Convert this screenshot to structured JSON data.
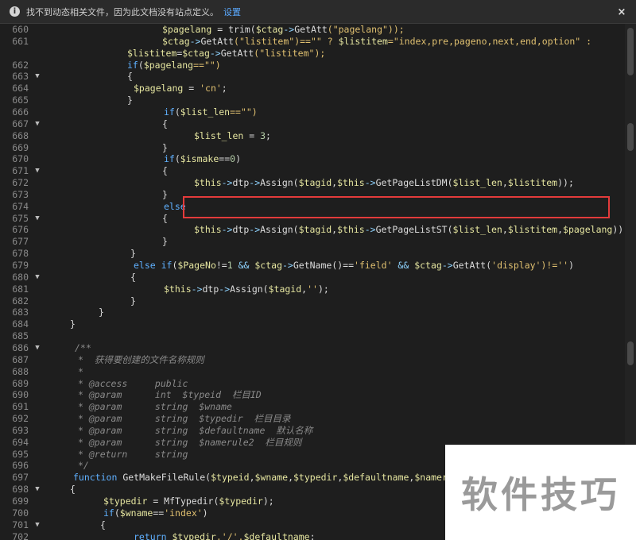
{
  "infobar": {
    "message": "找不到动态相关文件，因为此文档没有站点定义。",
    "link_label": "设置",
    "info_icon": "i",
    "close_icon": "×"
  },
  "watermark": "软件技巧",
  "lines": [
    {
      "num": "660",
      "fold": false,
      "indent": 204,
      "tokens": [
        [
          "$pagelang",
          "var"
        ],
        [
          " = ",
          "plain"
        ],
        [
          "trim",
          "fn"
        ],
        [
          "(",
          "plain"
        ],
        [
          "$ctag",
          "var"
        ],
        [
          "->",
          "op"
        ],
        [
          "GetAtt",
          "fn"
        ],
        [
          "(\"pagelang\"));",
          "str"
        ]
      ]
    },
    {
      "num": "661",
      "fold": false,
      "indent": 204,
      "tokens": [
        [
          "$ctag",
          "var"
        ],
        [
          "->",
          "op"
        ],
        [
          "GetAtt",
          "fn"
        ],
        [
          "(\"listitem\")==\"\" ? ",
          "str"
        ],
        [
          "$listitem",
          "var"
        ],
        [
          "=\"index,pre,pageno,next,end,option\" :",
          "str"
        ]
      ]
    },
    {
      "num": "",
      "fold": false,
      "indent": 160,
      "tokens": [
        [
          "$listitem",
          "var"
        ],
        [
          "=",
          "plain"
        ],
        [
          "$ctag",
          "var"
        ],
        [
          "->",
          "op"
        ],
        [
          "GetAtt",
          "fn"
        ],
        [
          "(\"listitem\");",
          "str"
        ]
      ]
    },
    {
      "num": "662",
      "fold": false,
      "indent": 160,
      "tokens": [
        [
          "if",
          "kw"
        ],
        [
          "(",
          "plain"
        ],
        [
          "$pagelang",
          "var"
        ],
        [
          "==\"\")",
          "str"
        ]
      ]
    },
    {
      "num": "663",
      "fold": true,
      "indent": 160,
      "tokens": [
        [
          "{",
          "plain"
        ]
      ]
    },
    {
      "num": "664",
      "fold": false,
      "indent": 168,
      "tokens": [
        [
          "$pagelang",
          "var"
        ],
        [
          " = ",
          "plain"
        ],
        [
          "'cn'",
          "str"
        ],
        [
          ";",
          "plain"
        ]
      ]
    },
    {
      "num": "665",
      "fold": false,
      "indent": 160,
      "tokens": [
        [
          "}",
          "plain"
        ]
      ]
    },
    {
      "num": "666",
      "fold": false,
      "indent": 206,
      "tokens": [
        [
          "if",
          "kw"
        ],
        [
          "(",
          "plain"
        ],
        [
          "$list_len",
          "var"
        ],
        [
          "==\"\")",
          "str"
        ]
      ]
    },
    {
      "num": "667",
      "fold": true,
      "indent": 204,
      "tokens": [
        [
          "{",
          "plain"
        ]
      ]
    },
    {
      "num": "668",
      "fold": false,
      "indent": 244,
      "tokens": [
        [
          "$list_len",
          "var"
        ],
        [
          " = ",
          "plain"
        ],
        [
          "3",
          "num"
        ],
        [
          ";",
          "plain"
        ]
      ]
    },
    {
      "num": "669",
      "fold": false,
      "indent": 204,
      "tokens": [
        [
          "}",
          "plain"
        ]
      ]
    },
    {
      "num": "670",
      "fold": false,
      "indent": 206,
      "tokens": [
        [
          "if",
          "kw"
        ],
        [
          "(",
          "plain"
        ],
        [
          "$ismake",
          "var"
        ],
        [
          "==",
          "plain"
        ],
        [
          "0",
          "num"
        ],
        [
          ")",
          "plain"
        ]
      ]
    },
    {
      "num": "671",
      "fold": true,
      "indent": 204,
      "tokens": [
        [
          "{",
          "plain"
        ]
      ]
    },
    {
      "num": "672",
      "fold": false,
      "indent": 244,
      "tokens": [
        [
          "$this",
          "var"
        ],
        [
          "->",
          "op"
        ],
        [
          "dtp",
          "plain"
        ],
        [
          "->",
          "op"
        ],
        [
          "Assign",
          "fn"
        ],
        [
          "(",
          "plain"
        ],
        [
          "$tagid",
          "var"
        ],
        [
          ",",
          "plain"
        ],
        [
          "$this",
          "var"
        ],
        [
          "->",
          "op"
        ],
        [
          "GetPageListDM",
          "fn"
        ],
        [
          "(",
          "plain"
        ],
        [
          "$list_len",
          "var"
        ],
        [
          ",",
          "plain"
        ],
        [
          "$listitem",
          "var"
        ],
        [
          "));",
          "plain"
        ]
      ]
    },
    {
      "num": "673",
      "fold": false,
      "indent": 204,
      "tokens": [
        [
          "}",
          "plain"
        ]
      ]
    },
    {
      "num": "674",
      "fold": false,
      "indent": 206,
      "tokens": [
        [
          "else",
          "kw"
        ]
      ]
    },
    {
      "num": "675",
      "fold": true,
      "indent": 204,
      "tokens": [
        [
          "{",
          "plain"
        ]
      ]
    },
    {
      "num": "676",
      "fold": false,
      "indent": 244,
      "tokens": [
        [
          "$this",
          "var"
        ],
        [
          "->",
          "op"
        ],
        [
          "dtp",
          "plain"
        ],
        [
          "->",
          "op"
        ],
        [
          "Assign",
          "fn"
        ],
        [
          "(",
          "plain"
        ],
        [
          "$tagid",
          "var"
        ],
        [
          ",",
          "plain"
        ],
        [
          "$this",
          "var"
        ],
        [
          "->",
          "op"
        ],
        [
          "GetPageListST",
          "fn"
        ],
        [
          "(",
          "plain"
        ],
        [
          "$list_len",
          "var"
        ],
        [
          ",",
          "plain"
        ],
        [
          "$listitem",
          "var"
        ],
        [
          ",",
          "plain"
        ],
        [
          "$pagelang",
          "var"
        ],
        [
          "));",
          "plain"
        ]
      ]
    },
    {
      "num": "677",
      "fold": false,
      "indent": 204,
      "tokens": [
        [
          "}",
          "plain"
        ]
      ]
    },
    {
      "num": "678",
      "fold": false,
      "indent": 164,
      "tokens": [
        [
          "}",
          "plain"
        ]
      ]
    },
    {
      "num": "679",
      "fold": false,
      "indent": 168,
      "tokens": [
        [
          "else if",
          "kw"
        ],
        [
          "(",
          "plain"
        ],
        [
          "$PageNo",
          "var"
        ],
        [
          "!=",
          "plain"
        ],
        [
          "1",
          "num"
        ],
        [
          " && ",
          "op"
        ],
        [
          "$ctag",
          "var"
        ],
        [
          "->",
          "op"
        ],
        [
          "GetName",
          "fn"
        ],
        [
          "()==",
          "plain"
        ],
        [
          "'field'",
          "str"
        ],
        [
          " && ",
          "op"
        ],
        [
          "$ctag",
          "var"
        ],
        [
          "->",
          "op"
        ],
        [
          "GetAtt",
          "fn"
        ],
        [
          "(",
          "plain"
        ],
        [
          "'display'",
          "str"
        ],
        [
          ")!=''",
          "str"
        ],
        [
          ")",
          "plain"
        ]
      ]
    },
    {
      "num": "680",
      "fold": true,
      "indent": 164,
      "tokens": [
        [
          "{",
          "plain"
        ]
      ]
    },
    {
      "num": "681",
      "fold": false,
      "indent": 206,
      "tokens": [
        [
          "$this",
          "var"
        ],
        [
          "->",
          "op"
        ],
        [
          "dtp",
          "plain"
        ],
        [
          "->",
          "op"
        ],
        [
          "Assign",
          "fn"
        ],
        [
          "(",
          "plain"
        ],
        [
          "$tagid",
          "var"
        ],
        [
          ",",
          "plain"
        ],
        [
          "''",
          "str"
        ],
        [
          ");",
          "plain"
        ]
      ]
    },
    {
      "num": "682",
      "fold": false,
      "indent": 164,
      "tokens": [
        [
          "}",
          "plain"
        ]
      ]
    },
    {
      "num": "683",
      "fold": false,
      "indent": 124,
      "tokens": [
        [
          "}",
          "plain"
        ]
      ]
    },
    {
      "num": "684",
      "fold": false,
      "indent": 88,
      "tokens": [
        [
          "}",
          "plain"
        ]
      ]
    },
    {
      "num": "685",
      "fold": false,
      "indent": 88,
      "tokens": []
    },
    {
      "num": "686",
      "fold": true,
      "indent": 94,
      "tokens": [
        [
          "/**",
          "cmt"
        ]
      ]
    },
    {
      "num": "687",
      "fold": false,
      "indent": 98,
      "tokens": [
        [
          "*  获得要创建的文件名称规则",
          "cmt"
        ]
      ]
    },
    {
      "num": "688",
      "fold": false,
      "indent": 98,
      "tokens": [
        [
          "*",
          "cmt"
        ]
      ]
    },
    {
      "num": "689",
      "fold": false,
      "indent": 98,
      "tokens": [
        [
          "* @access     public",
          "cmt"
        ]
      ]
    },
    {
      "num": "690",
      "fold": false,
      "indent": 98,
      "tokens": [
        [
          "* @param      int  $typeid  栏目ID",
          "cmt"
        ]
      ]
    },
    {
      "num": "691",
      "fold": false,
      "indent": 98,
      "tokens": [
        [
          "* @param      string  $wname",
          "cmt"
        ]
      ]
    },
    {
      "num": "692",
      "fold": false,
      "indent": 98,
      "tokens": [
        [
          "* @param      string  $typedir  栏目目录",
          "cmt"
        ]
      ]
    },
    {
      "num": "693",
      "fold": false,
      "indent": 98,
      "tokens": [
        [
          "* @param      string  $defaultname  默认名称",
          "cmt"
        ]
      ]
    },
    {
      "num": "694",
      "fold": false,
      "indent": 98,
      "tokens": [
        [
          "* @param      string  $namerule2  栏目规则",
          "cmt"
        ]
      ]
    },
    {
      "num": "695",
      "fold": false,
      "indent": 98,
      "tokens": [
        [
          "* @return     string",
          "cmt"
        ]
      ]
    },
    {
      "num": "696",
      "fold": false,
      "indent": 98,
      "tokens": [
        [
          "*/",
          "cmt"
        ]
      ]
    },
    {
      "num": "697",
      "fold": false,
      "indent": 92,
      "tokens": [
        [
          "function ",
          "kw"
        ],
        [
          "GetMakeFileRule",
          "fn"
        ],
        [
          "(",
          "plain"
        ],
        [
          "$typeid",
          "var"
        ],
        [
          ",",
          "plain"
        ],
        [
          "$wname",
          "var"
        ],
        [
          ",",
          "plain"
        ],
        [
          "$typedir",
          "var"
        ],
        [
          ",",
          "plain"
        ],
        [
          "$defaultname",
          "var"
        ],
        [
          ",",
          "plain"
        ],
        [
          "$namerule",
          "var"
        ]
      ]
    },
    {
      "num": "698",
      "fold": true,
      "indent": 88,
      "tokens": [
        [
          "{",
          "plain"
        ]
      ]
    },
    {
      "num": "699",
      "fold": false,
      "indent": 130,
      "tokens": [
        [
          "$typedir",
          "var"
        ],
        [
          " = ",
          "plain"
        ],
        [
          "MfTypedir",
          "fn"
        ],
        [
          "(",
          "plain"
        ],
        [
          "$typedir",
          "var"
        ],
        [
          ");",
          "plain"
        ]
      ]
    },
    {
      "num": "700",
      "fold": false,
      "indent": 130,
      "tokens": [
        [
          "if",
          "kw"
        ],
        [
          "(",
          "plain"
        ],
        [
          "$wname",
          "var"
        ],
        [
          "==",
          "plain"
        ],
        [
          "'index'",
          "str"
        ],
        [
          ")",
          "plain"
        ]
      ]
    },
    {
      "num": "701",
      "fold": true,
      "indent": 126,
      "tokens": [
        [
          "{",
          "plain"
        ]
      ]
    },
    {
      "num": "702",
      "fold": false,
      "indent": 168,
      "tokens": [
        [
          "return ",
          "kw"
        ],
        [
          "$typedir",
          "var"
        ],
        [
          ".'/'.",
          "str"
        ],
        [
          "$defaultname",
          "var"
        ],
        [
          ";",
          "plain"
        ]
      ]
    }
  ]
}
